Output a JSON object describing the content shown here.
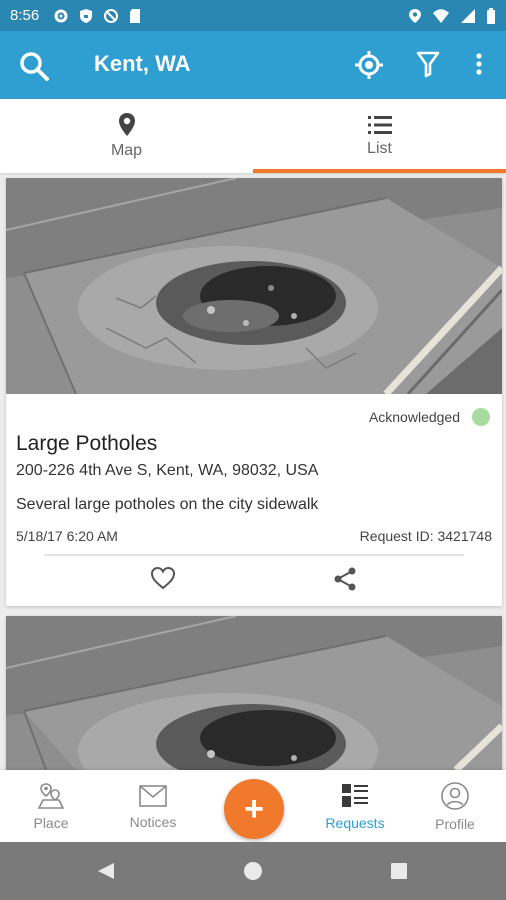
{
  "status_bar": {
    "time": "8:56"
  },
  "header": {
    "title": "Kent, WA"
  },
  "tabs": [
    {
      "label": "Map",
      "icon": "map-pin-icon",
      "active": false
    },
    {
      "label": "List",
      "icon": "list-icon",
      "active": true
    }
  ],
  "requests": [
    {
      "status": "Acknowledged",
      "status_color": "#a8dba0",
      "title": "Large Potholes",
      "address": "200-226 4th Ave S, Kent, WA, 98032, USA",
      "description": "Several large potholes on the city sidewalk",
      "date": "5/18/17 6:20 AM",
      "request_id": "Request ID: 3421748"
    }
  ],
  "bottom_nav": {
    "items": [
      {
        "label": "Place",
        "icon": "place-icon",
        "active": false
      },
      {
        "label": "Notices",
        "icon": "notices-icon",
        "active": false
      },
      {
        "label": "Requests",
        "icon": "requests-icon",
        "active": true
      },
      {
        "label": "Profile",
        "icon": "profile-icon",
        "active": false
      }
    ],
    "fab_label": "+"
  },
  "colors": {
    "app_bar": "#2f9ed1",
    "status_bar": "#2a86b3",
    "accent": "#f0792b"
  }
}
